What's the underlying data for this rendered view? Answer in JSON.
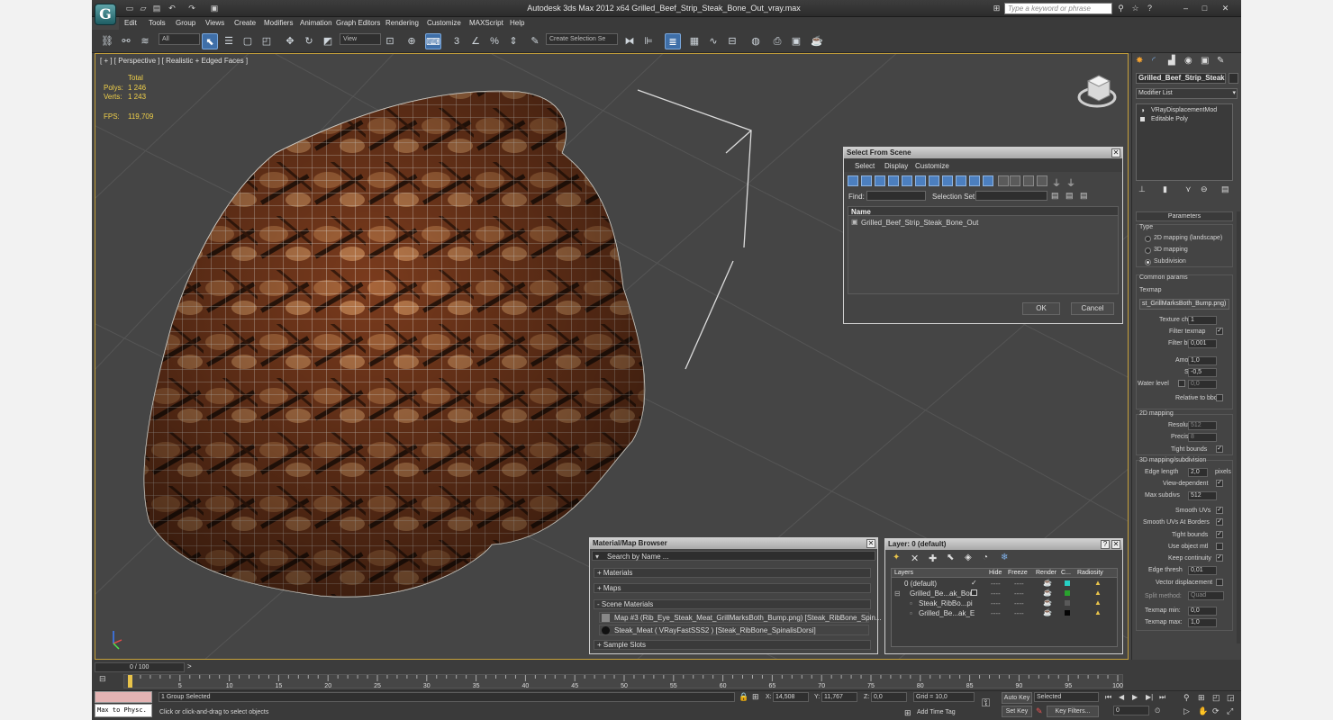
{
  "window": {
    "title": "Autodesk 3ds Max  2012 x64     Grilled_Beef_Strip_Steak_Bone_Out_vray.max",
    "search_placeholder": "Type a keyword or phrase",
    "app_logo": "3ds-max-logo"
  },
  "quick_access": [
    "new-icon",
    "open-icon",
    "save-icon",
    "undo-icon",
    "redo-icon",
    "project-icon"
  ],
  "title_buttons": [
    "binoculars-icon",
    "star-icon",
    "help-icon"
  ],
  "window_controls": [
    "minimize-icon",
    "maximize-icon",
    "close-icon"
  ],
  "menu": [
    "Edit",
    "Tools",
    "Group",
    "Views",
    "Create",
    "Modifiers",
    "Animation",
    "Graph Editors",
    "Rendering",
    "Customize",
    "MAXScript",
    "Help"
  ],
  "toolbar": {
    "filter_dropdown": "All",
    "coord_dropdown": "View",
    "selection_set": "Create Selection Se"
  },
  "viewport": {
    "label": "[ + ] [ Perspective ] [ Realistic + Edged Faces ]",
    "stats": {
      "total_label": "Total",
      "polys_label": "Polys:",
      "polys_value": "1 246",
      "verts_label": "Verts:",
      "verts_value": "1 243",
      "fps_label": "FPS:",
      "fps_value": "119,709"
    }
  },
  "select_from_scene": {
    "title": "Select From Scene",
    "menus": [
      "Select",
      "Display",
      "Customize"
    ],
    "find_label": "Find:",
    "selection_set_label": "Selection Set:",
    "column_name": "Name",
    "items": [
      "Grilled_Beef_Strip_Steak_Bone_Out"
    ],
    "ok": "OK",
    "cancel": "Cancel"
  },
  "material_browser": {
    "title": "Material/Map Browser",
    "search": "Search by Name ...",
    "sections": {
      "materials": "+ Materials",
      "maps": "+ Maps",
      "scene": "- Scene Materials",
      "sample": "+ Sample Slots"
    },
    "scene_items": [
      "Map #3 (Rib_Eye_Steak_Meat_GrillMarksBoth_Bump.png) [Steak_RibBone_Spin...",
      "Steak_Meat  ( VRayFastSSS2 ) [Steak_RibBone_SpinalisDorsi]"
    ]
  },
  "layer_dialog": {
    "title": "Layer: 0 (default)",
    "columns": {
      "layers": "Layers",
      "hide": "Hide",
      "freeze": "Freeze",
      "render": "Render",
      "color": "C...",
      "radiosity": "Radiosity"
    },
    "rows": [
      {
        "name": "0 (default)",
        "dash1": "----",
        "dash2": "----",
        "color": "#27d0c4"
      },
      {
        "name": "Grilled_Be...ak_Bon",
        "dash1": "----",
        "dash2": "----",
        "color": "#29a32e"
      },
      {
        "name": "Steak_RibBo...pi",
        "dash1": "----",
        "dash2": "----",
        "color": "#5a5a5a"
      },
      {
        "name": "Grilled_Be...ak_E",
        "dash1": "----",
        "dash2": "----",
        "color": "#050505"
      }
    ]
  },
  "command_panel": {
    "object_name": "Grilled_Beef_Strip_Steak",
    "modifier_list": "Modifier List",
    "stack": [
      "VRayDisplacementMod",
      "Editable Poly"
    ],
    "params_title": "Parameters",
    "type_label": "Type",
    "types": [
      "2D mapping (landscape)",
      "3D mapping",
      "Subdivision"
    ],
    "common_params": "Common params",
    "texmap_label": "Texmap",
    "texmap_value": "st_GrillMarksBoth_Bump.png)",
    "texture_chan_label": "Texture chan",
    "texture_chan": "1",
    "filter_texmap": "Filter texmap",
    "filter_blur_label": "Filter blur",
    "filter_blur": "0,001",
    "amount_label": "Amount",
    "amount": "1,0",
    "shift_label": "Shift",
    "shift": "-0,5",
    "water_label": "Water level",
    "water": "0,0",
    "relative_bbox": "Relative to bbox",
    "map2d_title": "2D mapping",
    "resolution_label": "Resolution",
    "resolution": "512",
    "precision_label": "Precision",
    "precision": "8",
    "tight_bounds": "Tight bounds",
    "map3d_title": "3D mapping/subdivision",
    "edge_length_label": "Edge length",
    "edge_length": "2,0",
    "pixels": "pixels",
    "view_dependent": "View-dependent",
    "max_subdivs_label": "Max subdivs",
    "max_subdivs": "512",
    "smooth_uvs": "Smooth UVs",
    "smooth_uvs_borders": "Smooth UVs At Borders",
    "tight_bounds2": "Tight bounds",
    "use_object_mtl": "Use object mtl",
    "keep_continuity": "Keep continuity",
    "edge_thresh_label": "Edge thresh",
    "edge_thresh": "0,01",
    "vector_disp": "Vector displacement",
    "split_method_label": "Split method:",
    "split_method": "Quad",
    "texmap_min_label": "Texmap min:",
    "texmap_min": "0,0",
    "texmap_max_label": "Texmap max:",
    "texmap_max": "1,0"
  },
  "timeline": {
    "frame": "0 / 100",
    "ticks": [
      "0",
      "5",
      "10",
      "15",
      "20",
      "25",
      "30",
      "35",
      "40",
      "45",
      "50",
      "55",
      "60",
      "65",
      "70",
      "75",
      "80",
      "85",
      "90",
      "95",
      "100"
    ]
  },
  "status": {
    "maxscript": "Max to Physc.",
    "selected": "1 Group Selected",
    "prompt": "Click or click-and-drag to select objects",
    "x_label": "X:",
    "x": "14,508",
    "y_label": "Y:",
    "y": "11,767",
    "z_label": "Z:",
    "z": "0,0",
    "grid": "Grid = 10,0",
    "add_time_tag": "Add Time Tag",
    "auto_key": "Auto Key",
    "set_key": "Set Key",
    "key_mode": "Selected",
    "key_filters": "Key Filters...",
    "frame_field": "0"
  }
}
